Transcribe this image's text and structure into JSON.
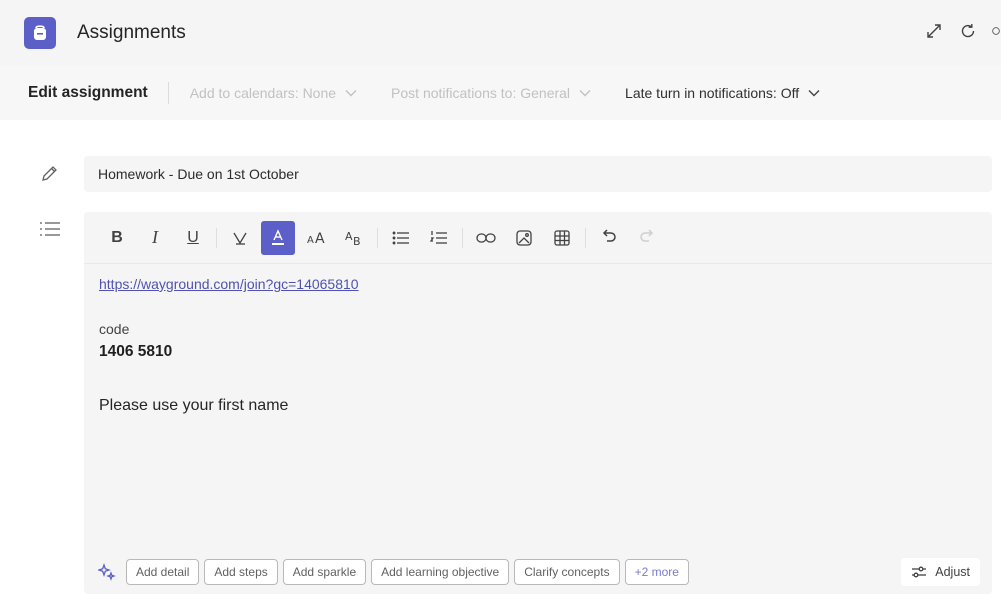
{
  "app": {
    "title": "Assignments",
    "icon": "assignments-backpack-icon",
    "accent": "#5b5fc7"
  },
  "title_actions": [
    "expand-icon",
    "refresh-icon",
    "more-icon"
  ],
  "editbar": {
    "title": "Edit assignment",
    "calendars": "Add to calendars: None",
    "notifications": "Post notifications to: General",
    "late_turn_in": "Late turn in notifications: Off"
  },
  "assignment": {
    "title": "Homework - Due on 1st October"
  },
  "format_toolbar": [
    "bold",
    "italic",
    "underline",
    "highlight",
    "font-color",
    "font-size",
    "text-style",
    "bullet-list",
    "numbered-list",
    "link",
    "image",
    "table",
    "undo",
    "redo"
  ],
  "instructions": {
    "link": "https://wayground.com/join?gc=14065810",
    "code_label": "code",
    "code_value": "1406 5810",
    "note": "Please use your first name"
  },
  "suggestions": {
    "chips": [
      "Add detail",
      "Add steps",
      "Add sparkle",
      "Add learning objective",
      "Clarify concepts",
      "+2 more"
    ],
    "adjust_label": "Adjust"
  }
}
